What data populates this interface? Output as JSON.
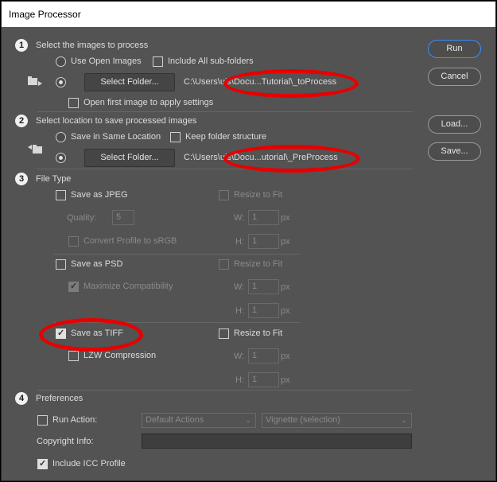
{
  "window": {
    "title": "Image Processor"
  },
  "section1": {
    "number": "1",
    "heading": "Select the images to process",
    "use_open_images": "Use Open Images",
    "include_subfolders": "Include All sub-folders",
    "select_folder": "Select Folder...",
    "path": "C:\\Users\\",
    "path_tail": "uis\\Docu...Tutorial\\_toProcess",
    "open_first_image": "Open first image to apply settings"
  },
  "section2": {
    "number": "2",
    "heading": "Select location to save processed images",
    "save_same_location": "Save in Same Location",
    "keep_folder_structure": "Keep folder structure",
    "select_folder": "Select Folder...",
    "path": "C:\\Users\\",
    "path_tail": "uis\\Docu...utorial\\_PreProcess"
  },
  "section3": {
    "number": "3",
    "heading": "File Type",
    "jpeg": {
      "save_as": "Save as JPEG",
      "resize_to_fit": "Resize to Fit",
      "quality_label": "Quality:",
      "quality_value": "5",
      "convert_profile": "Convert Profile to sRGB",
      "w_label": "W:",
      "w_value": "1",
      "h_label": "H:",
      "h_value": "1",
      "unit": "px"
    },
    "psd": {
      "save_as": "Save as PSD",
      "resize_to_fit": "Resize to Fit",
      "maximize_compat": "Maximize Compatibility",
      "w_label": "W:",
      "w_value": "1",
      "h_label": "H:",
      "h_value": "1",
      "unit": "px"
    },
    "tiff": {
      "save_as": "Save as TIFF",
      "resize_to_fit": "Resize to Fit",
      "lzw": "LZW Compression",
      "w_label": "W:",
      "w_value": "1",
      "h_label": "H:",
      "h_value": "1",
      "unit": "px"
    }
  },
  "section4": {
    "number": "4",
    "heading": "Preferences",
    "run_action": "Run Action:",
    "action_set": "Default Actions",
    "action": "Vignette (selection)",
    "copyright_label": "Copyright Info:",
    "copyright_value": "",
    "include_icc": "Include ICC Profile"
  },
  "buttons": {
    "run": "Run",
    "cancel": "Cancel",
    "load": "Load...",
    "save": "Save..."
  },
  "colors": {
    "background": "#535353",
    "accent": "#3b8cff",
    "annotation": "#e60000"
  }
}
